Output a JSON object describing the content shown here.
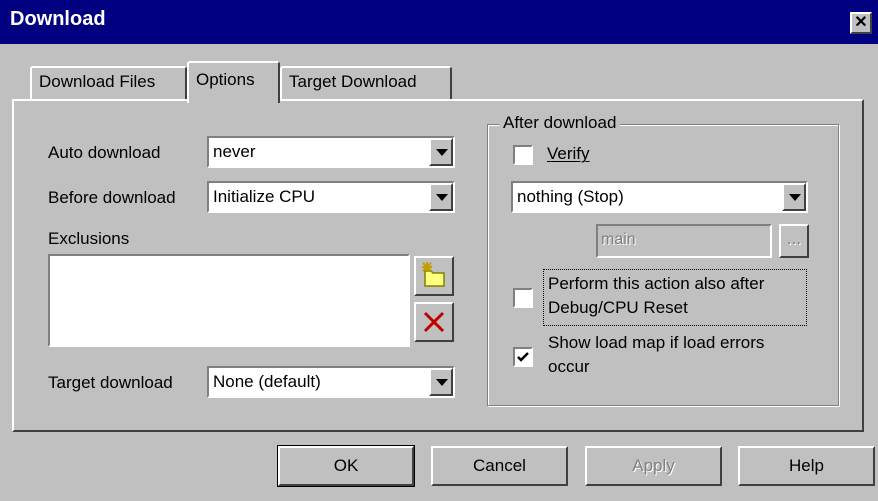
{
  "window": {
    "title": "Download",
    "close_glyph": "✕"
  },
  "tabs": [
    {
      "label": "Download Files",
      "active": false
    },
    {
      "label": "Options",
      "active": true
    },
    {
      "label": "Target Download",
      "active": false
    }
  ],
  "options": {
    "auto_download": {
      "label": "Auto download",
      "value": "never"
    },
    "before_download": {
      "label": "Before download",
      "value": "Initialize CPU"
    },
    "exclusions": {
      "label": "Exclusions",
      "add_icon": "new-folder-icon",
      "delete_icon": "delete-x-icon"
    },
    "target_download": {
      "label": "Target download",
      "value": "None (default)"
    }
  },
  "after_download": {
    "group_label": "After download",
    "verify": {
      "label": "Verify",
      "checked": false
    },
    "action": {
      "value": "nothing (Stop)"
    },
    "symbol": {
      "value": "main",
      "browse_label": "..."
    },
    "perform_after_reset": {
      "label_line1": "Perform this action also after",
      "label_line2": "Debug/CPU Reset",
      "checked": false
    },
    "show_load_map": {
      "label_line1": "Show load map if load errors",
      "label_line2": "occur",
      "checked": true
    }
  },
  "buttons": {
    "ok": "OK",
    "cancel": "Cancel",
    "apply": "Apply",
    "help": "Help"
  },
  "colors": {
    "title_bar": "#000080",
    "face": "#c0c0c0",
    "disabled_text": "#808080"
  }
}
